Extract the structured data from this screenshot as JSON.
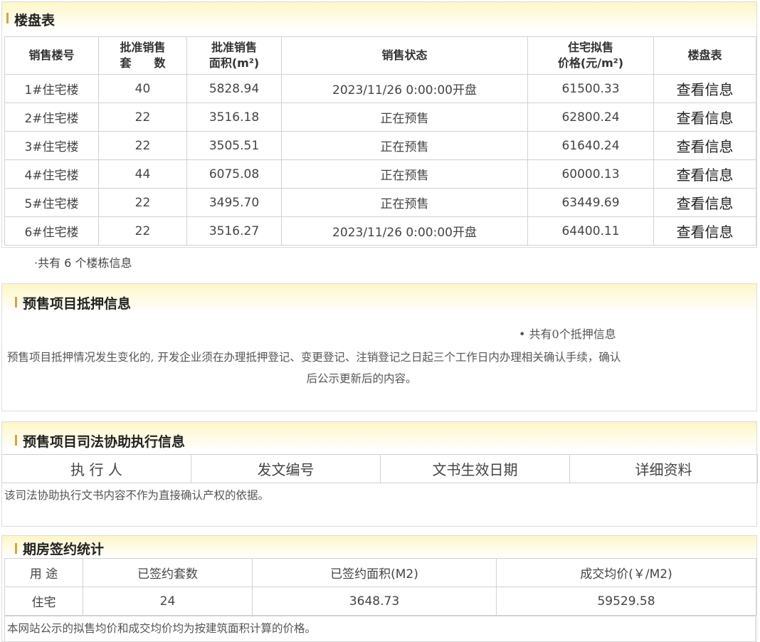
{
  "building_table": {
    "title": "楼盘表",
    "headers": [
      "销售楼号",
      "批准销售\n套　　数",
      "批准销售\n面积(m²)",
      "销售状态",
      "住宅拟售\n价格(元/m²)",
      "楼盘表"
    ],
    "rows": [
      [
        "1#住宅楼",
        "40",
        "5828.94",
        "2023/11/26 0:00:00开盘",
        "61500.33",
        "查看信息"
      ],
      [
        "2#住宅楼",
        "22",
        "3516.18",
        "正在预售",
        "62800.24",
        "查看信息"
      ],
      [
        "3#住宅楼",
        "22",
        "3505.51",
        "正在预售",
        "61640.24",
        "查看信息"
      ],
      [
        "4#住宅楼",
        "44",
        "6075.08",
        "正在预售",
        "60000.13",
        "查看信息"
      ],
      [
        "5#住宅楼",
        "22",
        "3495.70",
        "正在预售",
        "63449.69",
        "查看信息"
      ],
      [
        "6#住宅楼",
        "22",
        "3516.27",
        "2023/11/26 0:00:00开盘",
        "64400.11",
        "查看信息"
      ]
    ],
    "footer": "·共有 6 个楼栋信息"
  },
  "mortgage": {
    "title": "预售项目抵押信息",
    "count_text": "• 共有0个抵押信息",
    "notice_line1": "预售项目抵押情况发生变化的, 开发企业须在办理抵押登记、变更登记、注销登记之日起三个工作日内办理相关确认手续，确认",
    "notice_line2": "后公示更新后的内容。"
  },
  "judicial": {
    "title": "预售项目司法协助执行信息",
    "headers": [
      "执 行 人",
      "发文编号",
      "文书生效日期",
      "详细资料"
    ],
    "notice": "该司法协助执行文书内容不作为直接确认产权的依据。"
  },
  "contract_stats": {
    "title": "期房签约统计",
    "headers": [
      "用 途",
      "已签约套数",
      "已签约面积(M2)",
      "成交均价(￥/M2)"
    ],
    "rows": [
      [
        "住宅",
        "24",
        "3648.73",
        "59529.58"
      ]
    ],
    "notice": "本网站公示的拟售均价和成交均价均为按建筑面积计算的价格。"
  }
}
